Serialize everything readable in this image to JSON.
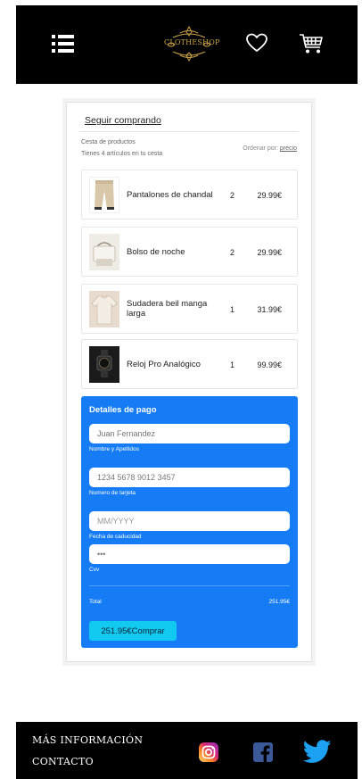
{
  "header": {
    "logo_text": "CLOTHESHOP",
    "menu_icon": "hamburger-menu-icon",
    "wishlist_icon": "heart-icon",
    "cart_icon": "shopping-cart-icon"
  },
  "cart": {
    "continue_label": "Seguir comprando",
    "title": "Cesta de productos",
    "subtitle": "Tienes 4 artículos en tu cesta",
    "order_by_label": "Ordenar por: ",
    "order_by_value": "precio",
    "items": [
      {
        "name": "Pantalones de chandal",
        "qty": "2",
        "price": "29.99€"
      },
      {
        "name": "Bolso de noche",
        "qty": "2",
        "price": "29.99€"
      },
      {
        "name": "Sudadera beil manga larga",
        "qty": "1",
        "price": "31.99€"
      },
      {
        "name": "Reloj Pro Analógico",
        "qty": "1",
        "price": "99.99€"
      }
    ]
  },
  "payment": {
    "title": "Detalles de pago",
    "name_value": "Juan Fernandez",
    "name_label": "Nombre y Apellidos",
    "card_value": "1234 5678 9012 3457",
    "card_label": "Numero de tarjeta",
    "expiry_placeholder": "MM/YYYY",
    "expiry_label": "Fecha de caducidad",
    "cvv_value": "•••",
    "cvv_label": "Cvv",
    "total_label": "Total",
    "total_value": "251.95€",
    "buy_label": "251.95€Comprar"
  },
  "footer": {
    "more_info": "MÁS INFORMACIÓN",
    "contact": "CONTACTO",
    "social": [
      "instagram-icon",
      "facebook-icon",
      "twitter-icon"
    ]
  },
  "colors": {
    "header_bg": "#000000",
    "payment_bg": "#157cf6",
    "buy_button": "#12c9f0",
    "logo_gold": "#c9a24a",
    "twitter_blue": "#1da1f2",
    "facebook_blue": "#3b5998"
  }
}
